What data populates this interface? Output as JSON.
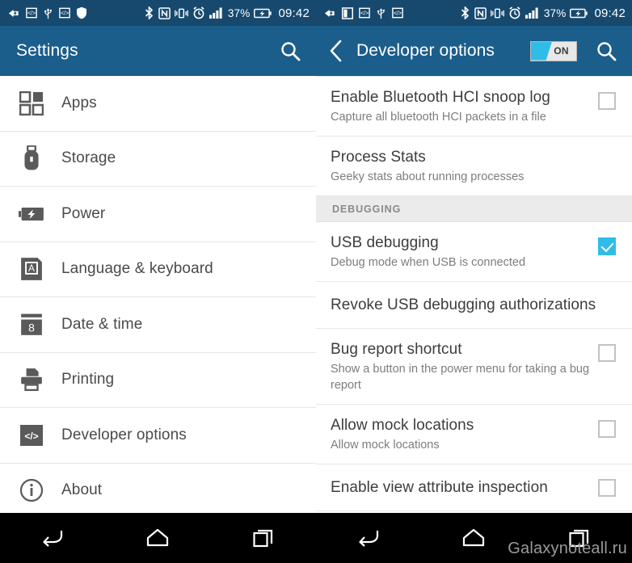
{
  "statusbar": {
    "left_icons_left_panel": [
      "back-arrow-badge-icon",
      "code-badge-icon",
      "usb-icon",
      "code-badge-icon",
      "shield-icon"
    ],
    "left_icons_right_panel": [
      "back-arrow-badge-icon",
      "split-screen-icon",
      "code-badge-icon",
      "usb-icon",
      "code-badge-icon"
    ],
    "right_icons": [
      "bluetooth-icon",
      "nfc-icon",
      "vibrate-icon",
      "alarm-icon",
      "signal-icon"
    ],
    "battery_percent": "37%",
    "clock": "09:42"
  },
  "left": {
    "header": {
      "title": "Settings",
      "search_icon": "search-icon"
    },
    "items": [
      {
        "label": "Apps",
        "icon": "apps-grid-icon"
      },
      {
        "label": "Storage",
        "icon": "usb-drive-icon"
      },
      {
        "label": "Power",
        "icon": "battery-bolt-icon"
      },
      {
        "label": "Language & keyboard",
        "icon": "language-a-icon"
      },
      {
        "label": "Date & time",
        "icon": "calendar-8-icon"
      },
      {
        "label": "Printing",
        "icon": "printer-icon"
      },
      {
        "label": "Developer options",
        "icon": "code-brackets-icon"
      },
      {
        "label": "About",
        "icon": "info-circle-icon"
      }
    ]
  },
  "right": {
    "header": {
      "back_icon": "chevron-left-icon",
      "title": "Developer options",
      "toggle_label": "ON",
      "toggle_state": "on",
      "search_icon": "search-icon"
    },
    "items": [
      {
        "type": "checkbox",
        "title": "Enable Bluetooth HCI snoop log",
        "subtitle": "Capture all bluetooth HCI packets in a file",
        "checked": false
      },
      {
        "type": "plain",
        "title": "Process Stats",
        "subtitle": "Geeky stats about running processes"
      },
      {
        "type": "section",
        "title": "DEBUGGING"
      },
      {
        "type": "checkbox",
        "title": "USB debugging",
        "subtitle": "Debug mode when USB is connected",
        "checked": true
      },
      {
        "type": "single",
        "title": "Revoke USB debugging authorizations"
      },
      {
        "type": "checkbox",
        "title": "Bug report shortcut",
        "subtitle": "Show a button in the power menu for taking a bug report",
        "checked": false
      },
      {
        "type": "checkbox",
        "title": "Allow mock locations",
        "subtitle": "Allow mock locations",
        "checked": false
      },
      {
        "type": "checkbox-single",
        "title": "Enable view attribute inspection",
        "checked": false
      }
    ]
  },
  "navbar": {
    "back_icon": "back-icon",
    "home_icon": "home-icon",
    "recents_icon": "recents-icon"
  },
  "watermark": "Galaxynoteall.ru",
  "colors": {
    "statusbar": "#17496e",
    "actionbar": "#1b5e8c",
    "accent": "#2fbde8",
    "navbar": "#000000",
    "section_bg": "#ebebeb"
  }
}
